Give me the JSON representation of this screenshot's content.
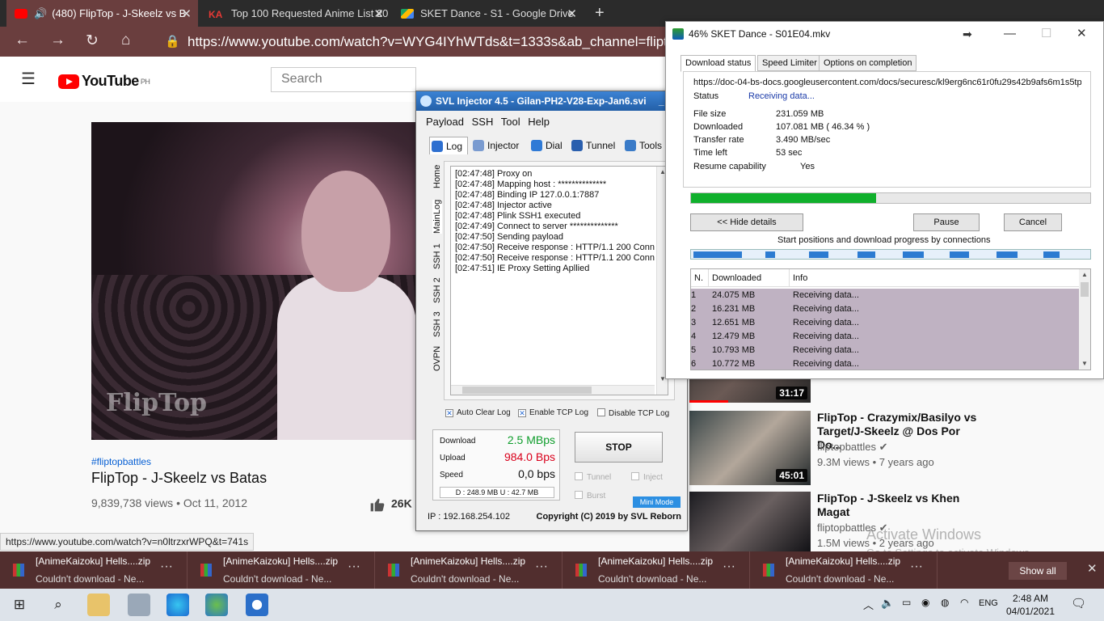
{
  "browser": {
    "tabs": [
      {
        "title": "(480) FlipTop - J-Skeelz vs B",
        "icon": "youtube-icon",
        "color": "#ff0000"
      },
      {
        "title": "Top 100 Requested Anime List 20",
        "icon": "ka-icon",
        "color": "#e53935"
      },
      {
        "title": "SKET Dance - S1 - Google Drive",
        "icon": "google-drive-icon",
        "color": "#1ea362"
      }
    ],
    "new_tab": "+",
    "url": "https://www.youtube.com/watch?v=WYG4IYhWTds&t=1333s&ab_channel=fliptopba"
  },
  "youtube": {
    "logo": "YouTube",
    "region": "PH",
    "search_placeholder": "Search",
    "hashtag": "#fliptopbattles",
    "video_title": "FlipTop - J-Skeelz vs Batas",
    "video_meta": "9,839,738 views • Oct 11, 2012",
    "likes": "26K",
    "watermark": "FlipTop",
    "status_url": "https://www.youtube.com/watch?v=n0ltrzxrWPQ&t=741s",
    "activate_title": "Activate Windows",
    "activate_sub": "Go to Settings to activate Windows.",
    "recommendations": [
      {
        "title": "",
        "channel": "",
        "meta": "",
        "duration": "31:17"
      },
      {
        "title": "FlipTop - Crazymix/Basilyo vs Target/J-Skeelz @ Dos Por Do...",
        "channel": "fliptopbattles",
        "meta": "9.3M views • 7 years ago",
        "duration": "45:01"
      },
      {
        "title": "FlipTop - J-Skeelz vs Khen Magat",
        "channel": "fliptopbattles",
        "meta": "1.5M views • 2 years ago",
        "duration": ""
      }
    ]
  },
  "svl": {
    "title": "SVL Injector 4.5 - Gilan-PH2-V28-Exp-Jan6.svi",
    "menu": [
      "Payload",
      "SSH",
      "Tool",
      "Help"
    ],
    "tabs": [
      "Log",
      "Injector",
      "Dial",
      "Tunnel",
      "Tools"
    ],
    "side_tabs": [
      "Home",
      "MainLog",
      "SSH 1",
      "SSH 2",
      "SSH 3",
      "OVPN"
    ],
    "log": [
      "[02:47:48] Proxy on",
      "[02:47:48] Mapping host : **************",
      "[02:47:48] Binding IP 127.0.0.1:7887",
      "[02:47:48] Injector active",
      "[02:47:48] Plink SSH1 executed",
      "[02:47:49] Connect to server **************",
      "[02:47:50] Sending payload",
      "[02:47:50] Receive response : HTTP/1.1 200 Conn",
      "[02:47:50] Receive response : HTTP/1.1 200 Conn",
      "[02:47:51] IE Proxy Setting Apllied"
    ],
    "checks": [
      {
        "label": "Auto Clear Log",
        "checked": true
      },
      {
        "label": "Enable TCP Log",
        "checked": true
      },
      {
        "label": "Disable TCP Log",
        "checked": false
      }
    ],
    "download_label": "Download",
    "download_value": "2.5 MBps",
    "upload_label": "Upload",
    "upload_value": "984.0 Bps",
    "speed_label": "Speed",
    "speed_value": "0,0 bps",
    "du": "D :  248.9 MB    U :   42.7 MB",
    "stop": "STOP",
    "tunnel": "Tunnel",
    "inject": "Inject",
    "burst": "Burst",
    "mini_mode": "Mini Mode",
    "ip": "IP : 192.168.254.102",
    "copyright": "Copyright (C) 2019 by SVL Reborn",
    "colors": {
      "download": "#0f9d2c",
      "upload": "#d9001b"
    }
  },
  "idm": {
    "title": "46% SKET Dance - S01E04.mkv",
    "tabs": [
      "Download status",
      "Speed Limiter",
      "Options on completion"
    ],
    "url": "https://doc-04-bs-docs.googleusercontent.com/docs/securesc/kl9erg6nc61r0fu29s42b9afs6m1s5tp",
    "status_label": "Status",
    "status_value": "Receiving data...",
    "rows": [
      {
        "label": "File size",
        "value": "231.059  MB"
      },
      {
        "label": "Downloaded",
        "value": "107.081  MB  ( 46.34 % )"
      },
      {
        "label": "Transfer rate",
        "value": "3.490  MB/sec"
      },
      {
        "label": "Time left",
        "value": "53 sec"
      },
      {
        "label": "Resume capability",
        "value": "Yes"
      }
    ],
    "progress": 0.4634,
    "hide_details": "<< Hide details",
    "pause": "Pause",
    "cancel": "Cancel",
    "connections_caption": "Start positions and download progress by connections",
    "table_headers": [
      "N.",
      "Downloaded",
      "Info"
    ],
    "connections": [
      {
        "n": "1",
        "downloaded": "24.075  MB",
        "info": "Receiving data..."
      },
      {
        "n": "2",
        "downloaded": "16.231  MB",
        "info": "Receiving data..."
      },
      {
        "n": "3",
        "downloaded": "12.651  MB",
        "info": "Receiving data..."
      },
      {
        "n": "4",
        "downloaded": "12.479  MB",
        "info": "Receiving data..."
      },
      {
        "n": "5",
        "downloaded": "10.793  MB",
        "info": "Receiving data..."
      },
      {
        "n": "6",
        "downloaded": "10.772  MB",
        "info": "Receiving data..."
      }
    ]
  },
  "downloads": {
    "items": [
      {
        "name": "[AnimeKaizoku] Hells....zip",
        "status": "Couldn't download - Ne..."
      },
      {
        "name": "[AnimeKaizoku] Hells....zip",
        "status": "Couldn't download - Ne..."
      },
      {
        "name": "[AnimeKaizoku] Hells....zip",
        "status": "Couldn't download - Ne..."
      },
      {
        "name": "[AnimeKaizoku] Hells....zip",
        "status": "Couldn't download - Ne..."
      },
      {
        "name": "[AnimeKaizoku] Hells....zip",
        "status": "Couldn't download - Ne..."
      }
    ],
    "show_all": "Show all",
    "more": "···"
  },
  "taskbar": {
    "lang": "ENG",
    "time": "2:48 AM",
    "date": "04/01/2021"
  }
}
